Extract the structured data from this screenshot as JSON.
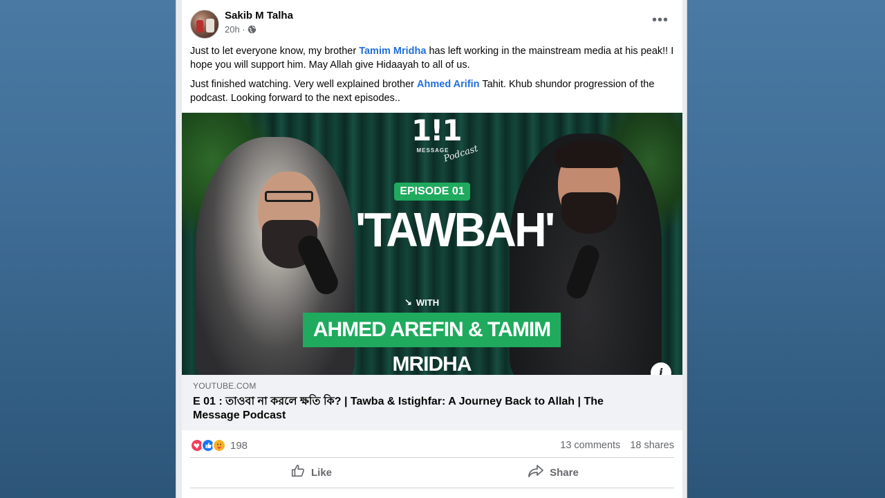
{
  "post": {
    "author": "Sakib M Talha",
    "time": "20h ·",
    "paragraph1": {
      "before": "Just to let everyone know, my brother ",
      "mention": "Tamim Mridha",
      "after": " has left working in the mainstream media at his peak!! I hope you will support him. May Allah give Hidaayah to all of us."
    },
    "paragraph2": {
      "before": "Just finished watching. Very well explained brother ",
      "mention": "Ahmed Arifin",
      "after": " Tahit. Khub shundor progression of the podcast. Looking forward to the next episodes.."
    }
  },
  "thumbnail": {
    "brand_word": "MESSAGE",
    "brand_script": "Podcast",
    "episode": "EPISODE 01",
    "headline": "'TAWBAH'",
    "with": "WITH",
    "names": "AHMED AREFIN & TAMIM MRIDHA"
  },
  "link_preview": {
    "domain": "YOUTUBE.COM",
    "title": "E 01 : তাওবা না করলে ক্ষতি কি? | Tawba & Istighfar: A Journey Back to Allah | The Message Podcast"
  },
  "engagement": {
    "reaction_count": "198",
    "comments": "13 comments",
    "shares": "18 shares"
  },
  "actions": {
    "like": "Like",
    "share": "Share"
  },
  "icons": {
    "reactions": [
      "love-icon",
      "like-icon",
      "care-icon"
    ],
    "colors": {
      "love": "#f33e58",
      "like": "#1877f2",
      "care": "#f7b125",
      "accent": "#1faa5e",
      "link": "#216fdb"
    }
  }
}
